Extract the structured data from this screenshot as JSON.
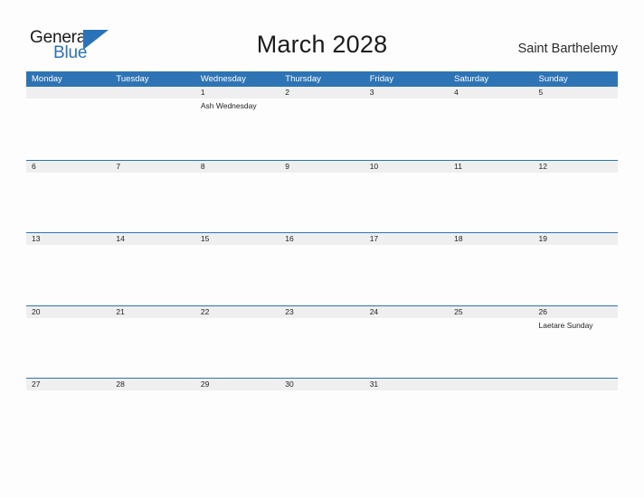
{
  "brand": {
    "name_part1": "General",
    "name_part2": "Blue",
    "logo_color": "#2a73b8"
  },
  "header": {
    "title": "March 2028",
    "location": "Saint Barthelemy",
    "accent_color": "#2e74b5",
    "band_color": "#efefef"
  },
  "calendar": {
    "weekdays": [
      "Monday",
      "Tuesday",
      "Wednesday",
      "Thursday",
      "Friday",
      "Saturday",
      "Sunday"
    ],
    "weeks": [
      {
        "days": [
          {
            "date": "",
            "event": ""
          },
          {
            "date": "",
            "event": ""
          },
          {
            "date": "1",
            "event": "Ash Wednesday"
          },
          {
            "date": "2",
            "event": ""
          },
          {
            "date": "3",
            "event": ""
          },
          {
            "date": "4",
            "event": ""
          },
          {
            "date": "5",
            "event": ""
          }
        ]
      },
      {
        "days": [
          {
            "date": "6",
            "event": ""
          },
          {
            "date": "7",
            "event": ""
          },
          {
            "date": "8",
            "event": ""
          },
          {
            "date": "9",
            "event": ""
          },
          {
            "date": "10",
            "event": ""
          },
          {
            "date": "11",
            "event": ""
          },
          {
            "date": "12",
            "event": ""
          }
        ]
      },
      {
        "days": [
          {
            "date": "13",
            "event": ""
          },
          {
            "date": "14",
            "event": ""
          },
          {
            "date": "15",
            "event": ""
          },
          {
            "date": "16",
            "event": ""
          },
          {
            "date": "17",
            "event": ""
          },
          {
            "date": "18",
            "event": ""
          },
          {
            "date": "19",
            "event": ""
          }
        ]
      },
      {
        "days": [
          {
            "date": "20",
            "event": ""
          },
          {
            "date": "21",
            "event": ""
          },
          {
            "date": "22",
            "event": ""
          },
          {
            "date": "23",
            "event": ""
          },
          {
            "date": "24",
            "event": ""
          },
          {
            "date": "25",
            "event": ""
          },
          {
            "date": "26",
            "event": "Laetare Sunday"
          }
        ]
      },
      {
        "days": [
          {
            "date": "27",
            "event": ""
          },
          {
            "date": "28",
            "event": ""
          },
          {
            "date": "29",
            "event": ""
          },
          {
            "date": "30",
            "event": ""
          },
          {
            "date": "31",
            "event": ""
          },
          {
            "date": "",
            "event": ""
          },
          {
            "date": "",
            "event": ""
          }
        ]
      }
    ]
  }
}
